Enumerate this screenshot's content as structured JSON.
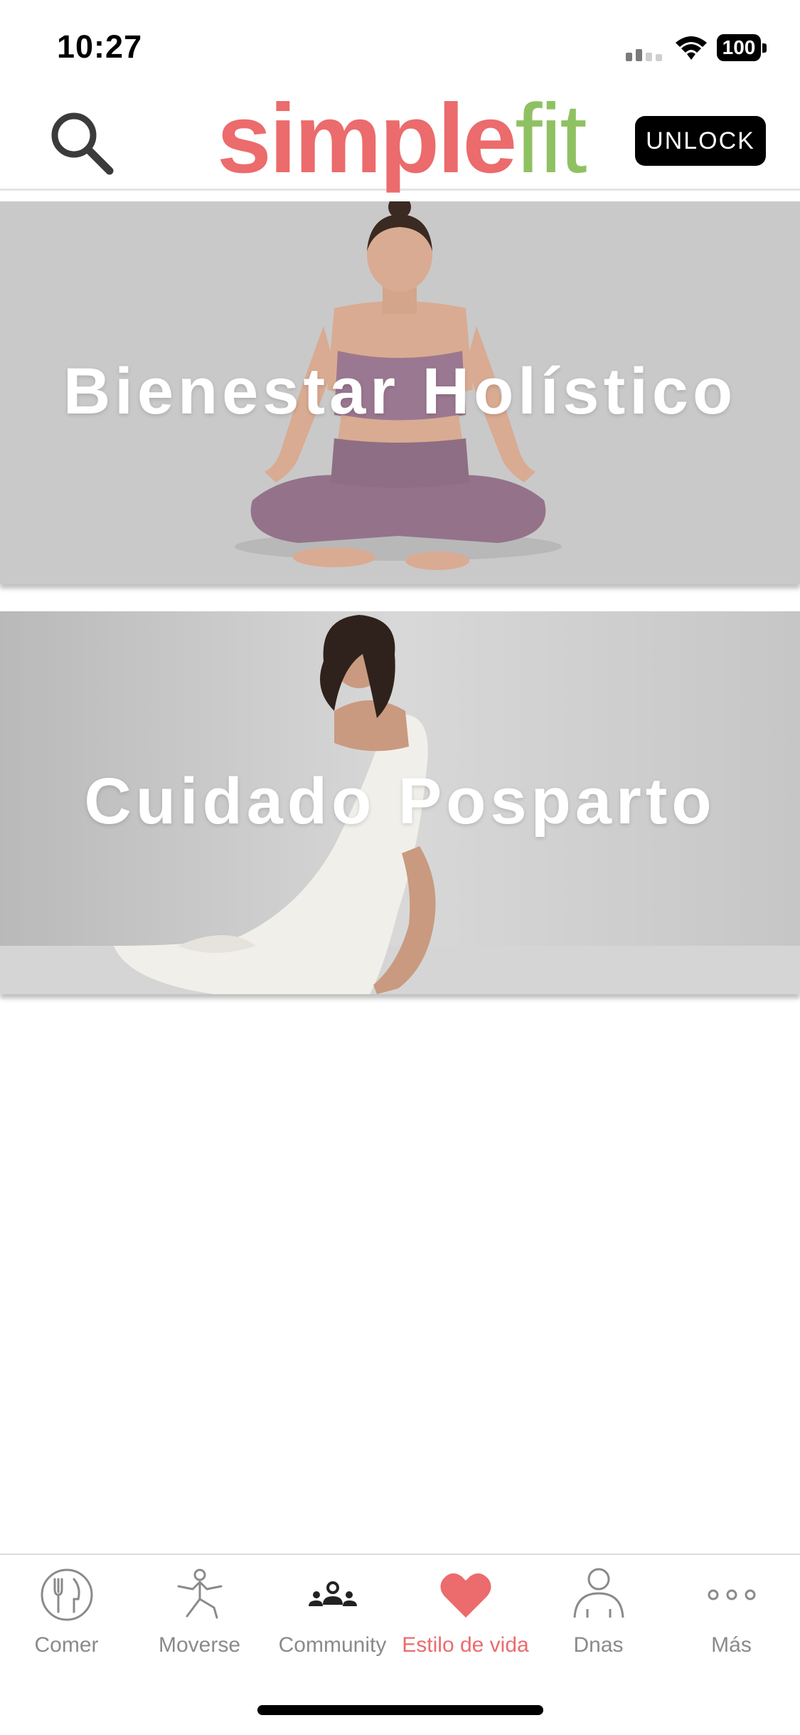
{
  "status_bar": {
    "time": "10:27",
    "battery": "100"
  },
  "header": {
    "logo": {
      "part1": "simple",
      "part2": "fit"
    },
    "unlock_label": "UNLOCK",
    "search_icon": "search-icon"
  },
  "cards": [
    {
      "title": "Bienestar Holístico"
    },
    {
      "title": "Cuidado Posparto"
    }
  ],
  "tabs": [
    {
      "label": "Comer",
      "icon": "fork-knife-icon"
    },
    {
      "label": "Moverse",
      "icon": "figure-icon"
    },
    {
      "label": "Community",
      "icon": "community-icon"
    },
    {
      "label": "Estilo de vida",
      "icon": "heart-icon",
      "active": true
    },
    {
      "label": "Dnas",
      "icon": "person-icon"
    },
    {
      "label": "Más",
      "icon": "more-icon"
    }
  ],
  "colors": {
    "brand_red": "#ec6b6c",
    "brand_green": "#8fc162",
    "tab_inactive": "#8a8a8a"
  }
}
